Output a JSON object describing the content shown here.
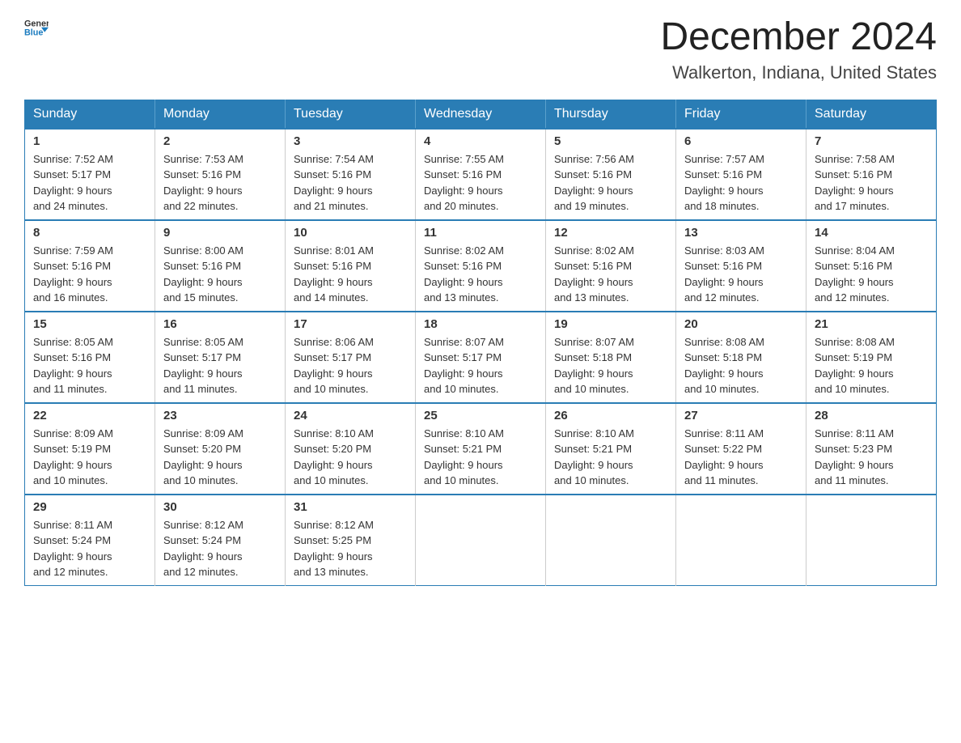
{
  "logo": {
    "text_general": "General",
    "text_blue": "Blue",
    "tagline": "GeneralBlue"
  },
  "header": {
    "month": "December 2024",
    "location": "Walkerton, Indiana, United States"
  },
  "weekdays": [
    "Sunday",
    "Monday",
    "Tuesday",
    "Wednesday",
    "Thursday",
    "Friday",
    "Saturday"
  ],
  "weeks": [
    [
      {
        "day": "1",
        "sunrise": "7:52 AM",
        "sunset": "5:17 PM",
        "daylight": "9 hours and 24 minutes."
      },
      {
        "day": "2",
        "sunrise": "7:53 AM",
        "sunset": "5:16 PM",
        "daylight": "9 hours and 22 minutes."
      },
      {
        "day": "3",
        "sunrise": "7:54 AM",
        "sunset": "5:16 PM",
        "daylight": "9 hours and 21 minutes."
      },
      {
        "day": "4",
        "sunrise": "7:55 AM",
        "sunset": "5:16 PM",
        "daylight": "9 hours and 20 minutes."
      },
      {
        "day": "5",
        "sunrise": "7:56 AM",
        "sunset": "5:16 PM",
        "daylight": "9 hours and 19 minutes."
      },
      {
        "day": "6",
        "sunrise": "7:57 AM",
        "sunset": "5:16 PM",
        "daylight": "9 hours and 18 minutes."
      },
      {
        "day": "7",
        "sunrise": "7:58 AM",
        "sunset": "5:16 PM",
        "daylight": "9 hours and 17 minutes."
      }
    ],
    [
      {
        "day": "8",
        "sunrise": "7:59 AM",
        "sunset": "5:16 PM",
        "daylight": "9 hours and 16 minutes."
      },
      {
        "day": "9",
        "sunrise": "8:00 AM",
        "sunset": "5:16 PM",
        "daylight": "9 hours and 15 minutes."
      },
      {
        "day": "10",
        "sunrise": "8:01 AM",
        "sunset": "5:16 PM",
        "daylight": "9 hours and 14 minutes."
      },
      {
        "day": "11",
        "sunrise": "8:02 AM",
        "sunset": "5:16 PM",
        "daylight": "9 hours and 13 minutes."
      },
      {
        "day": "12",
        "sunrise": "8:02 AM",
        "sunset": "5:16 PM",
        "daylight": "9 hours and 13 minutes."
      },
      {
        "day": "13",
        "sunrise": "8:03 AM",
        "sunset": "5:16 PM",
        "daylight": "9 hours and 12 minutes."
      },
      {
        "day": "14",
        "sunrise": "8:04 AM",
        "sunset": "5:16 PM",
        "daylight": "9 hours and 12 minutes."
      }
    ],
    [
      {
        "day": "15",
        "sunrise": "8:05 AM",
        "sunset": "5:16 PM",
        "daylight": "9 hours and 11 minutes."
      },
      {
        "day": "16",
        "sunrise": "8:05 AM",
        "sunset": "5:17 PM",
        "daylight": "9 hours and 11 minutes."
      },
      {
        "day": "17",
        "sunrise": "8:06 AM",
        "sunset": "5:17 PM",
        "daylight": "9 hours and 10 minutes."
      },
      {
        "day": "18",
        "sunrise": "8:07 AM",
        "sunset": "5:17 PM",
        "daylight": "9 hours and 10 minutes."
      },
      {
        "day": "19",
        "sunrise": "8:07 AM",
        "sunset": "5:18 PM",
        "daylight": "9 hours and 10 minutes."
      },
      {
        "day": "20",
        "sunrise": "8:08 AM",
        "sunset": "5:18 PM",
        "daylight": "9 hours and 10 minutes."
      },
      {
        "day": "21",
        "sunrise": "8:08 AM",
        "sunset": "5:19 PM",
        "daylight": "9 hours and 10 minutes."
      }
    ],
    [
      {
        "day": "22",
        "sunrise": "8:09 AM",
        "sunset": "5:19 PM",
        "daylight": "9 hours and 10 minutes."
      },
      {
        "day": "23",
        "sunrise": "8:09 AM",
        "sunset": "5:20 PM",
        "daylight": "9 hours and 10 minutes."
      },
      {
        "day": "24",
        "sunrise": "8:10 AM",
        "sunset": "5:20 PM",
        "daylight": "9 hours and 10 minutes."
      },
      {
        "day": "25",
        "sunrise": "8:10 AM",
        "sunset": "5:21 PM",
        "daylight": "9 hours and 10 minutes."
      },
      {
        "day": "26",
        "sunrise": "8:10 AM",
        "sunset": "5:21 PM",
        "daylight": "9 hours and 10 minutes."
      },
      {
        "day": "27",
        "sunrise": "8:11 AM",
        "sunset": "5:22 PM",
        "daylight": "9 hours and 11 minutes."
      },
      {
        "day": "28",
        "sunrise": "8:11 AM",
        "sunset": "5:23 PM",
        "daylight": "9 hours and 11 minutes."
      }
    ],
    [
      {
        "day": "29",
        "sunrise": "8:11 AM",
        "sunset": "5:24 PM",
        "daylight": "9 hours and 12 minutes."
      },
      {
        "day": "30",
        "sunrise": "8:12 AM",
        "sunset": "5:24 PM",
        "daylight": "9 hours and 12 minutes."
      },
      {
        "day": "31",
        "sunrise": "8:12 AM",
        "sunset": "5:25 PM",
        "daylight": "9 hours and 13 minutes."
      },
      null,
      null,
      null,
      null
    ]
  ],
  "labels": {
    "sunrise": "Sunrise:",
    "sunset": "Sunset:",
    "daylight": "Daylight:"
  }
}
